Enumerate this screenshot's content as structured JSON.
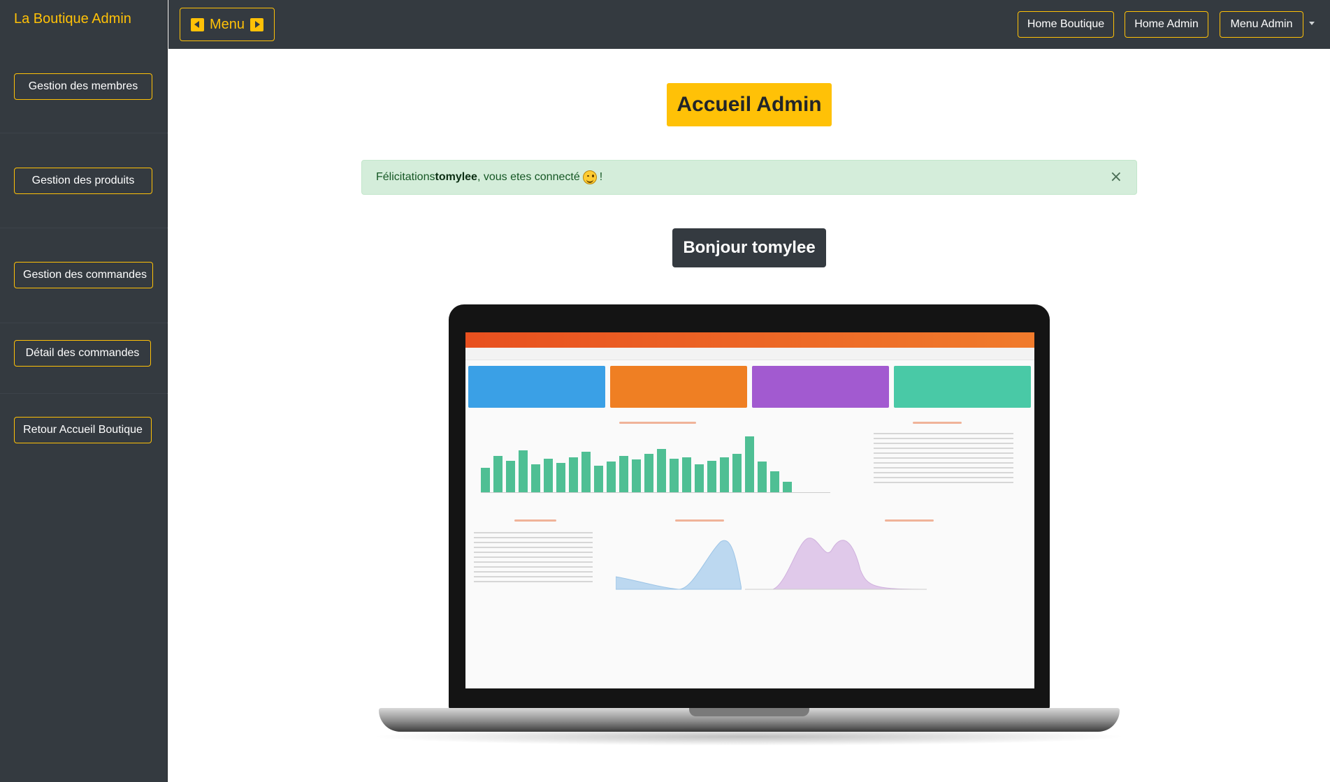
{
  "sidebar": {
    "brand": "La Boutique Admin",
    "items": [
      {
        "label": "Gestion  des  membres"
      },
      {
        "label": "Gestion   des   produits"
      },
      {
        "label": "Gestion des commandes"
      },
      {
        "label": "Détail des commandes"
      },
      {
        "label": "Retour Accueil Boutique"
      }
    ]
  },
  "topbar": {
    "menu_label": "Menu",
    "links": [
      {
        "label": "Home Boutique"
      },
      {
        "label": "Home Admin"
      },
      {
        "label": "Menu Admin"
      }
    ]
  },
  "main": {
    "title": "Accueil Admin",
    "alert": {
      "prefix": "Félicitations ",
      "user": "tomylee",
      "suffix": ", vous etes connecté",
      "end": " !",
      "close": "×"
    },
    "greeting": "Bonjour tomylee"
  },
  "colors": {
    "accent": "#ffc107",
    "dark": "#343a40",
    "alert_bg": "#d4edda",
    "alert_text": "#155724"
  },
  "illustration": {
    "description_icon": "laptop-dashboard-image",
    "tiles": [
      "#3aa0e6",
      "#ef7f23",
      "#a25ad0",
      "#49c9a6"
    ],
    "bars": [
      35,
      52,
      45,
      60,
      40,
      48,
      42,
      50,
      58,
      38,
      44,
      52,
      47,
      55,
      62,
      48,
      50,
      40,
      45,
      50,
      55,
      80,
      44,
      30,
      15
    ]
  }
}
